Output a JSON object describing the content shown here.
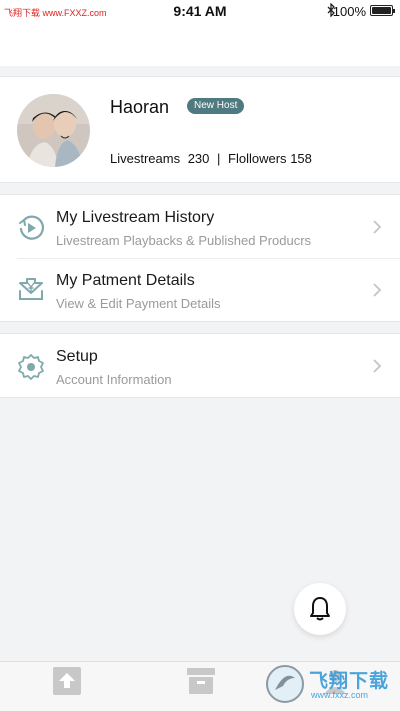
{
  "status_bar": {
    "carrier": "飞翔下载 www.FXXZ.com",
    "time": "9:41 AM",
    "battery": "100%"
  },
  "profile": {
    "name": "Haoran",
    "badge": "New Host",
    "livestreams_label": "Livestreams",
    "livestreams_count": "230",
    "separator": "|",
    "followers_label": "Flollowers",
    "followers_count": "158"
  },
  "menu": {
    "livestream_history": {
      "title": "My Livestream History",
      "subtitle": "Livestream Playbacks & Published Producrs"
    },
    "payment_details": {
      "title": "My Patment Details",
      "subtitle": "View & Edit Payment Details"
    },
    "setup": {
      "title": "Setup",
      "subtitle": "Account Information"
    }
  },
  "watermark": {
    "title": "飞翔下载",
    "url": "www.fxxz.com"
  },
  "colors": {
    "accent": "#4f7a80",
    "icon": "#7fa9ad",
    "background": "#f2f3f5"
  },
  "icons": {
    "history": "play-history-icon",
    "payment": "yen-download-icon",
    "setup": "gear-icon",
    "bell": "bell-icon",
    "tab_upload": "upload-icon",
    "tab_store": "store-icon",
    "tab_profile": "profile-icon"
  }
}
